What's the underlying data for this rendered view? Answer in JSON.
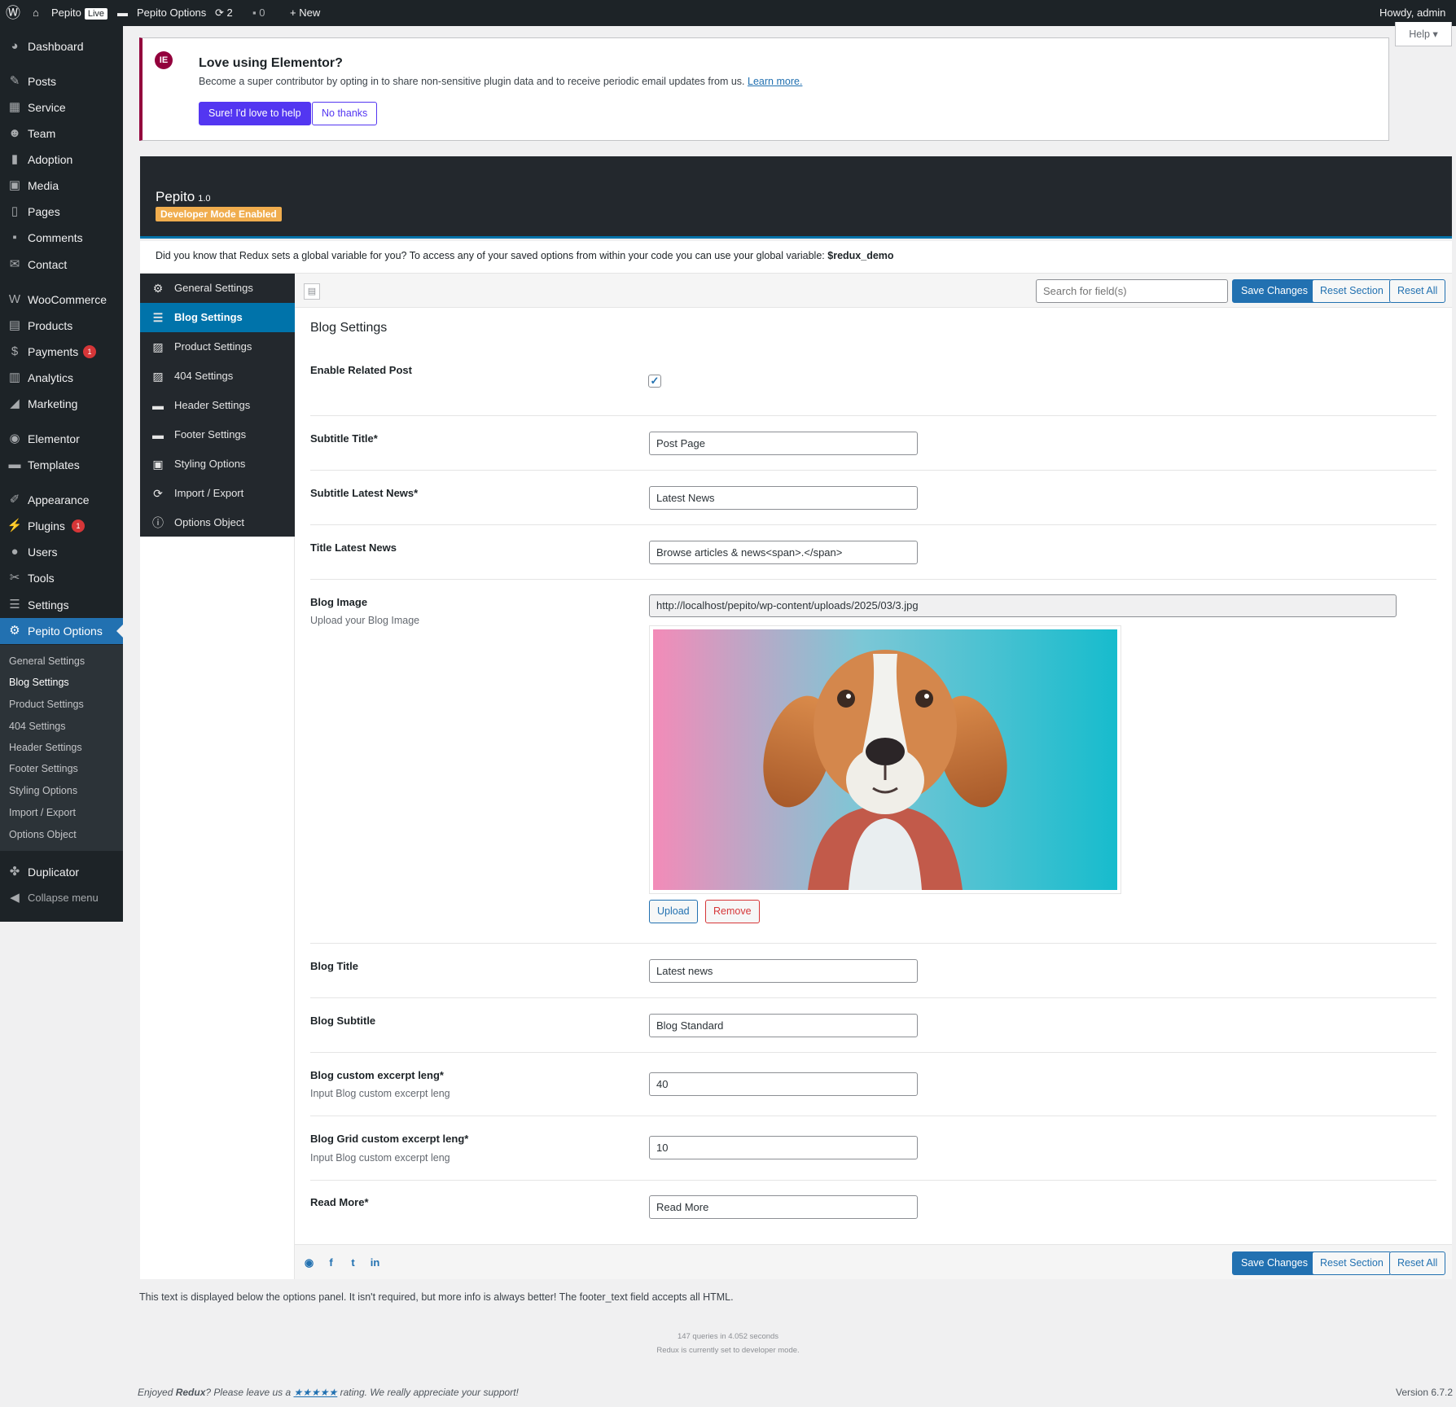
{
  "adminbar": {
    "site_name": "Pepito",
    "live_badge": "Live",
    "options_label": "Pepito Options",
    "updates_count": "2",
    "comments_count": "0",
    "new_label": "New",
    "howdy": "Howdy, admin"
  },
  "menu": {
    "items": [
      {
        "label": "Dashboard",
        "icon": "dashboard-icon"
      },
      {
        "label": "Posts",
        "icon": "pin-icon"
      },
      {
        "label": "Service",
        "icon": "grid-icon"
      },
      {
        "label": "Team",
        "icon": "people-icon"
      },
      {
        "label": "Adoption",
        "icon": "book-icon"
      },
      {
        "label": "Media",
        "icon": "media-icon"
      },
      {
        "label": "Pages",
        "icon": "page-icon"
      },
      {
        "label": "Comments",
        "icon": "comment-icon"
      },
      {
        "label": "Contact",
        "icon": "mail-icon"
      },
      {
        "label": "WooCommerce",
        "icon": "woo-icon"
      },
      {
        "label": "Products",
        "icon": "archive-icon"
      },
      {
        "label": "Payments",
        "icon": "dollar-icon",
        "badge": "1"
      },
      {
        "label": "Analytics",
        "icon": "bar-chart-icon"
      },
      {
        "label": "Marketing",
        "icon": "megaphone-icon"
      },
      {
        "label": "Elementor",
        "icon": "elementor-icon"
      },
      {
        "label": "Templates",
        "icon": "folder-icon"
      },
      {
        "label": "Appearance",
        "icon": "brush-icon"
      },
      {
        "label": "Plugins",
        "icon": "plug-icon",
        "badge": "1"
      },
      {
        "label": "Users",
        "icon": "user-icon"
      },
      {
        "label": "Tools",
        "icon": "wrench-icon"
      },
      {
        "label": "Settings",
        "icon": "sliders-icon"
      },
      {
        "label": "Pepito Options",
        "icon": "gear-icon"
      }
    ],
    "submenu": [
      "General Settings",
      "Blog Settings",
      "Product Settings",
      "404 Settings",
      "Header Settings",
      "Footer Settings",
      "Styling Options",
      "Import / Export",
      "Options Object"
    ],
    "duplicator": "Duplicator",
    "collapse": "Collapse menu"
  },
  "help_label": "Help ▾",
  "notice": {
    "logo": "IE",
    "title": "Love using Elementor?",
    "text": "Become a super contributor by opting in to share non-sensitive plugin data and to receive periodic email updates from us.",
    "link": "Learn more.",
    "yes_label": "Sure! I'd love to help",
    "no_label": "No thanks"
  },
  "redux": {
    "title": "Pepito",
    "version": "1.0",
    "dev_badge": "Developer Mode Enabled",
    "info_text": "Did you know that Redux sets a global variable for you? To access any of your saved options from within your code you can use your global variable:",
    "info_var": "$redux_demo",
    "nav": [
      {
        "label": "General Settings",
        "icon": "cogs-icon"
      },
      {
        "label": "Blog Settings",
        "icon": "list-icon"
      },
      {
        "label": "Product Settings",
        "icon": "chart-icon"
      },
      {
        "label": "404 Settings",
        "icon": "chart-icon"
      },
      {
        "label": "Header Settings",
        "icon": "header-icon"
      },
      {
        "label": "Footer Settings",
        "icon": "footer-icon"
      },
      {
        "label": "Styling Options",
        "icon": "window-icon"
      },
      {
        "label": "Import / Export",
        "icon": "refresh-icon"
      },
      {
        "label": "Options Object",
        "icon": "info-icon"
      }
    ],
    "search_placeholder": "Search for field(s)",
    "save_label": "Save Changes",
    "reset_section_label": "Reset Section",
    "reset_all_label": "Reset All"
  },
  "section": {
    "title": "Blog Settings",
    "fields": {
      "related": {
        "label": "Enable Related Post",
        "checked": true
      },
      "subtitle_title": {
        "label": "Subtitle Title*",
        "value": "Post Page"
      },
      "subtitle_news": {
        "label": "Subtitle Latest News*",
        "value": "Latest News"
      },
      "title_news": {
        "label": "Title Latest News",
        "value": "Browse articles & news<span>.</span>"
      },
      "blog_image": {
        "label": "Blog Image",
        "desc": "Upload your Blog Image",
        "url": "http://localhost/pepito/wp-content/uploads/2025/03/3.jpg",
        "upload_label": "Upload",
        "remove_label": "Remove"
      },
      "blog_title": {
        "label": "Blog Title",
        "value": "Latest news"
      },
      "blog_subtitle": {
        "label": "Blog Subtitle",
        "value": "Blog Standard"
      },
      "excerpt": {
        "label": "Blog custom excerpt leng*",
        "desc": "Input Blog custom excerpt leng",
        "value": "40"
      },
      "grid_excerpt": {
        "label": "Blog Grid custom excerpt leng*",
        "desc": "Input Blog custom excerpt leng",
        "value": "10"
      },
      "read_more": {
        "label": "Read More*",
        "value": "Read More"
      }
    }
  },
  "footer": {
    "below_text": "This text is displayed below the options panel. It isn't required, but more info is always better! The footer_text field accepts all HTML.",
    "queries": "147 queries in 4.052 seconds",
    "dev_mode": "Redux is currently set to developer mode.",
    "enjoy_pre": "Enjoyed",
    "enjoy_brand": "Redux",
    "enjoy_mid": "? Please leave us a",
    "stars": "★★★★★",
    "enjoy_post": "rating. We really appreciate your support!",
    "version": "Version 6.7.2"
  },
  "colors": {
    "accent": "#2271b1",
    "admin_dark": "#1d2327",
    "elementor": "#93003c",
    "dev_badge": "#f0ad4e",
    "remove": "#d63638"
  }
}
